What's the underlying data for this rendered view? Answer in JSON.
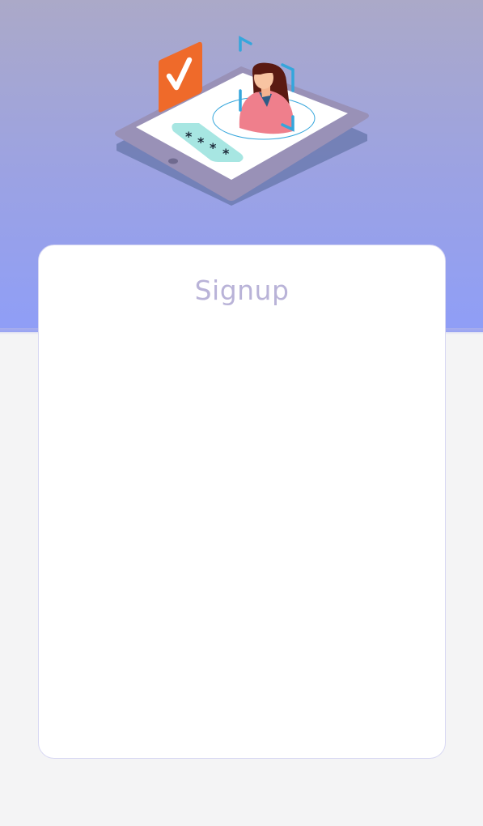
{
  "signup_card": {
    "title": "Signup"
  },
  "illustration": {
    "name": "tablet-face-id-illustration",
    "password_mask": "* * * *"
  },
  "colors": {
    "hero_top": "#aba9c8",
    "hero_bottom": "#8f9ef7",
    "page_background": "#f4f4f5",
    "card_background": "#ffffff",
    "card_border": "#d8d8f3",
    "title_color": "#b9b3d8",
    "check_badge": "#ef6a2a",
    "scan_frame": "#35a6dc",
    "password_pill": "#a7e6e2"
  }
}
